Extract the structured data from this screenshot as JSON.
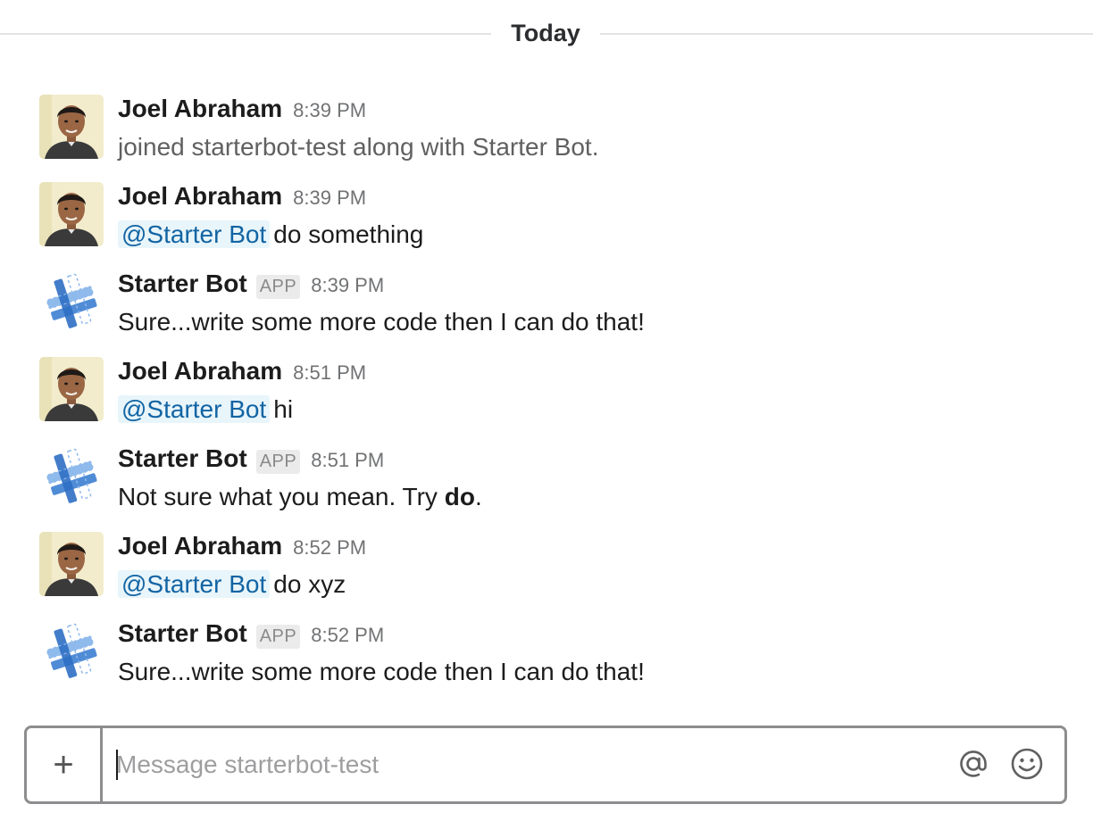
{
  "day_divider": {
    "label": "Today"
  },
  "messages": [
    {
      "sender": "Joel Abraham",
      "type": "user",
      "time": "8:39 PM",
      "app_badge": "",
      "mention": "",
      "text": "joined starterbot-test along with Starter Bot.",
      "style": "system"
    },
    {
      "sender": "Joel Abraham",
      "type": "user",
      "time": "8:39 PM",
      "app_badge": "",
      "mention": "@Starter Bot",
      "text": "do something",
      "style": "normal"
    },
    {
      "sender": "Starter Bot",
      "type": "bot",
      "time": "8:39 PM",
      "app_badge": "APP",
      "mention": "",
      "text": "Sure...write some more code then I can do that!",
      "style": "normal"
    },
    {
      "sender": "Joel Abraham",
      "type": "user",
      "time": "8:51 PM",
      "app_badge": "",
      "mention": "@Starter Bot",
      "text": "hi",
      "style": "normal"
    },
    {
      "sender": "Starter Bot",
      "type": "bot",
      "time": "8:51 PM",
      "app_badge": "APP",
      "mention": "",
      "text_before": "Not sure what you mean. Try ",
      "text_bold": "do",
      "text_after": ".",
      "style": "normal"
    },
    {
      "sender": "Joel Abraham",
      "type": "user",
      "time": "8:52 PM",
      "app_badge": "",
      "mention": "@Starter Bot",
      "text": "do xyz",
      "style": "normal"
    },
    {
      "sender": "Starter Bot",
      "type": "bot",
      "time": "8:52 PM",
      "app_badge": "APP",
      "mention": "",
      "text": "Sure...write some more code then I can do that!",
      "style": "normal"
    }
  ],
  "composer": {
    "add_label": "+",
    "placeholder": "Message starterbot-test",
    "icons": [
      "at-icon",
      "emoji-icon"
    ]
  },
  "colors": {
    "mention_text": "#1264a3",
    "mention_bg": "#e8f5fa",
    "bot_blue": "#3d7fd1"
  }
}
